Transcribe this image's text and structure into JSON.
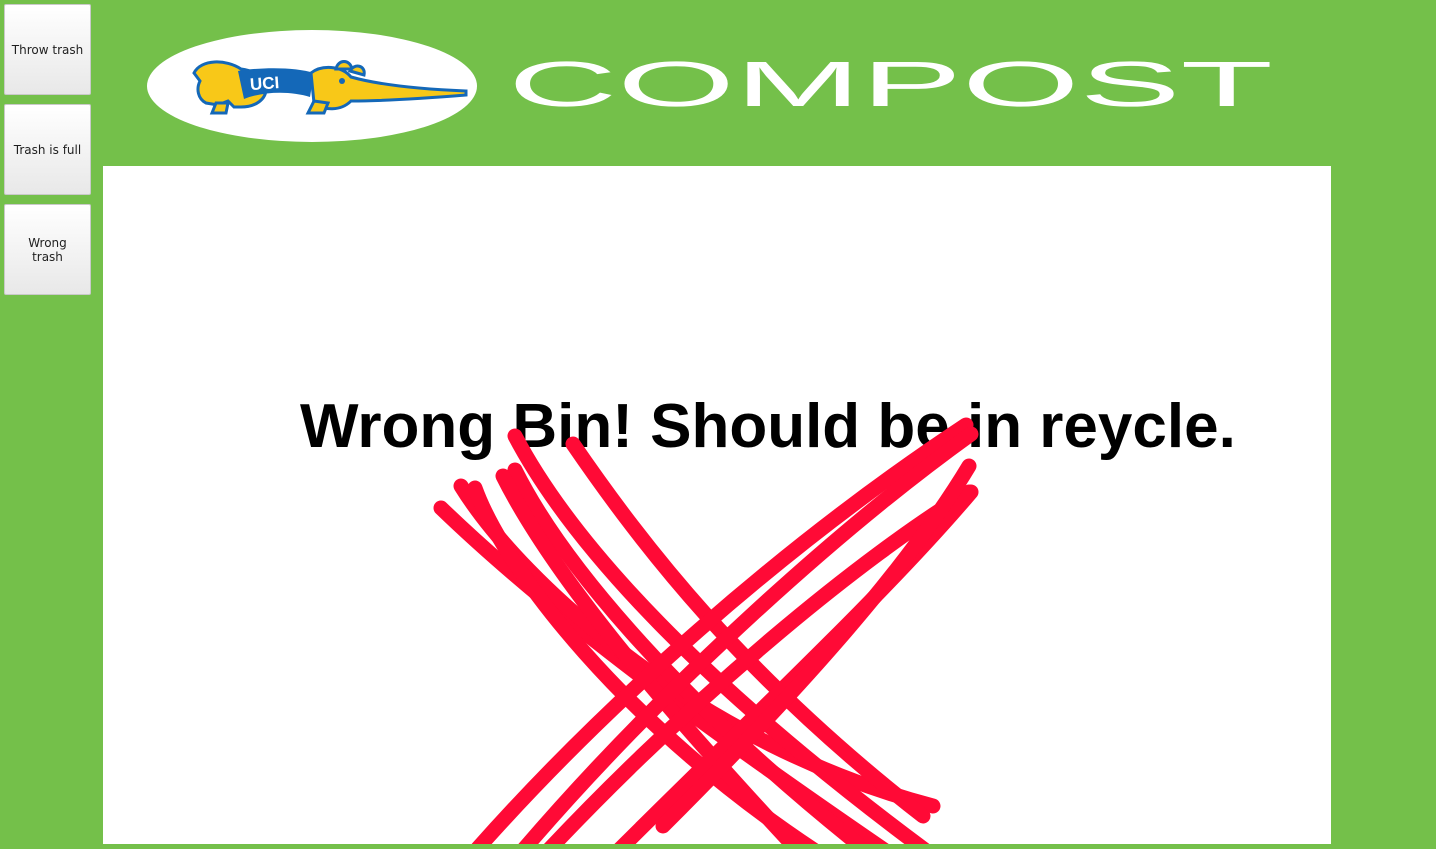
{
  "sidebar": {
    "buttons": [
      {
        "label": "Throw trash"
      },
      {
        "label": "Trash is full"
      },
      {
        "label": "Wrong trash"
      }
    ]
  },
  "header": {
    "title": "COMPOST",
    "logo_text": "UCI",
    "logo_icon": "anteater-logo-icon"
  },
  "main": {
    "message": "Wrong Bin! Should be in reycle.",
    "status_icon": "red-x-icon"
  },
  "colors": {
    "background": "#74c04a",
    "panel": "#ffffff",
    "x_mark": "#ff0a36",
    "logo_blue": "#1468b8",
    "logo_gold": "#f8c818"
  }
}
